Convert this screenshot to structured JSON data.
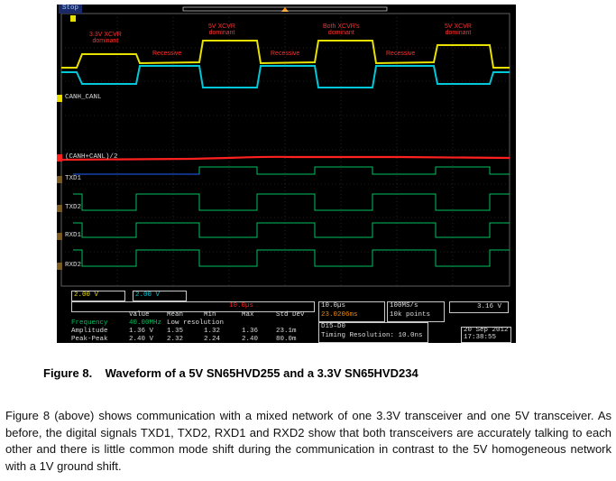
{
  "scope": {
    "run_state": "Stop",
    "bus_states": [
      "3.3V XCVR\ndominant",
      "Recessive",
      "5V XCVR\ndominant",
      "Recessive",
      "Both XCVR's\ndominant",
      "Recessive",
      "5V XCVR\ndominant"
    ],
    "channel_labels": {
      "canh_canl": "CANH_CANL",
      "common_mode": "(CANH+CANL)/2",
      "txd1": "TXD1",
      "txd2": "TXD2",
      "rxd1": "RXD1",
      "rxd2": "RXD2"
    },
    "ch1_scale": "2.00 V",
    "ch2_scale": "2.00 V",
    "math_scale": "10.0µs",
    "meas_header": {
      "value": "Value",
      "mean": "Mean",
      "min": "Min",
      "max": "Max",
      "std": "Std Dev"
    },
    "meas_rows": [
      {
        "name": "Frequency",
        "value": "40.00MHz",
        "mean": "Low resolution",
        "min": "",
        "max": "",
        "std": ""
      },
      {
        "name": "Amplitude",
        "value": "1.36 V",
        "mean": "1.35",
        "min": "1.32",
        "max": "1.36",
        "std": "23.1m"
      },
      {
        "name": "Peak-Peak",
        "value": "2.40 V",
        "mean": "2.32",
        "min": "2.24",
        "max": "2.40",
        "std": "80.0m"
      }
    ],
    "timebase": "10.0µs",
    "trigger_pos": "23.0206ms",
    "sample_rate": "100MS/s",
    "record_length": "10k points",
    "digital_group": "D15–D0",
    "timing_res": "Timing Resolution: 10.0ns",
    "trigger_level": "3.16 V",
    "date": "20 Sep 2012",
    "time": "17:38:55"
  },
  "figure_caption": "Figure 8.    Waveform of a 5V SN65HVD255 and a 3.3V SN65HVD234",
  "paragraph": "Figure 8 (above) shows communication with a mixed network of one 3.3V transceiver and one 5V transceiver. As before, the digital signals TXD1, TXD2, RXD1 and RXD2 show that both transceivers are accurately talking to each other and there is  little common mode shift during the communication in contrast to the 5V homogeneous network with a 1V ground shift.",
  "colors": {
    "ch1": "#e8e000",
    "ch2": "#00c8d8",
    "math": "#ff2020",
    "digital": "#00c060",
    "grid": "#505050"
  }
}
